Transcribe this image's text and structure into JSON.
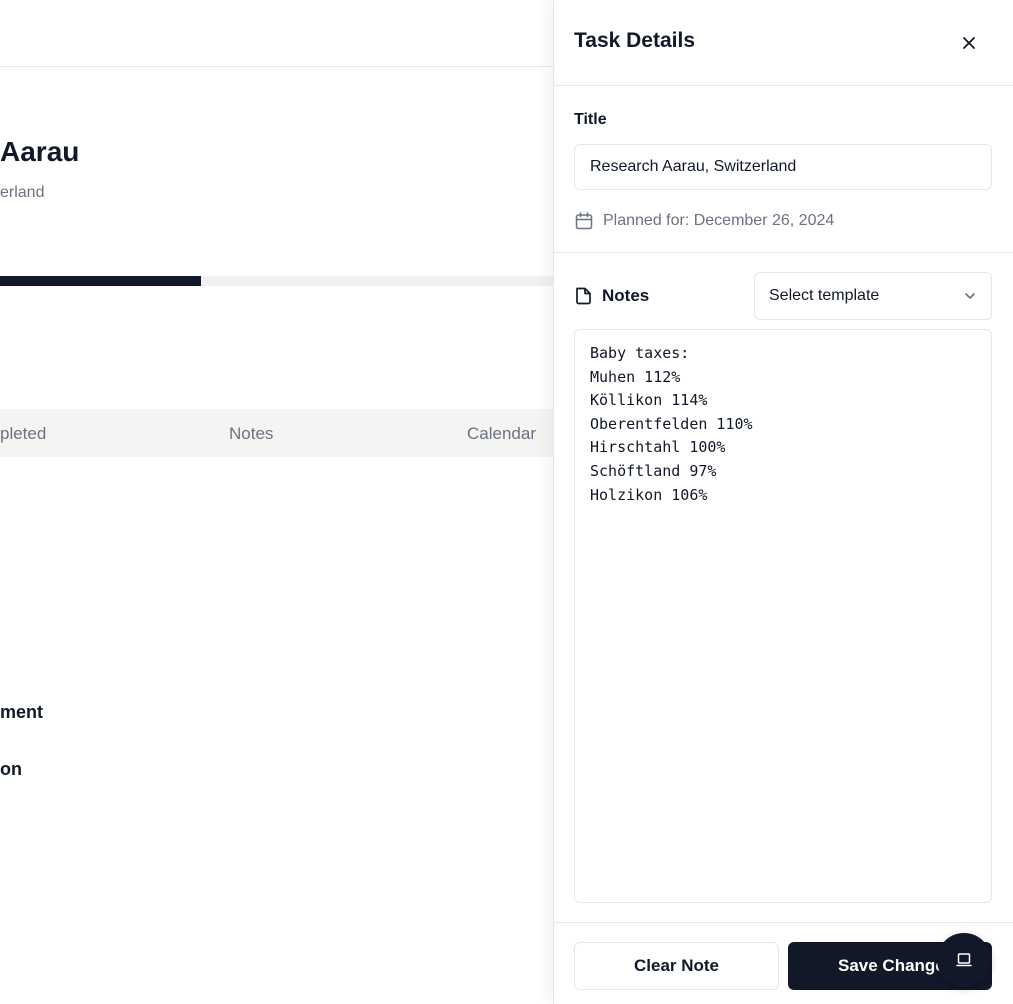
{
  "background": {
    "title": "Aarau",
    "subtitle": "erland",
    "progress": 0.364,
    "table_columns": [
      "pleted",
      "Notes",
      "Calendar"
    ],
    "items": [
      "ment",
      "on"
    ]
  },
  "drawer": {
    "title": "Task Details",
    "title_label": "Title",
    "title_value": "Research Aarau, Switzerland",
    "planned_text": "Planned for: December 26, 2024",
    "notes_label": "Notes",
    "template_select_value": "Select template",
    "notes_value": "Baby taxes:\nMuhen 112%\nKöllikon 114%\nOberentfelden 110%\nHirschtahl 100%\nSchöftland 97%\nHolzikon 106%",
    "clear_label": "Clear Note",
    "save_label": "Save Changes"
  },
  "icons": {
    "close": "close-icon",
    "calendar": "calendar-icon",
    "notes": "document-icon",
    "chevron": "chevron-down-icon",
    "fab": "laptop-icon"
  },
  "colors": {
    "primary": "#111827",
    "muted": "#6b7280",
    "border": "#e5e7eb"
  }
}
